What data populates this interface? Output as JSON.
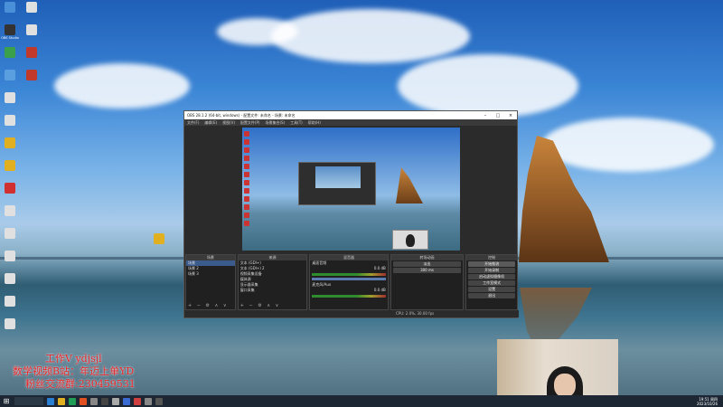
{
  "desktop": {
    "icons": [
      {
        "label": "",
        "color": "#4a90d9"
      },
      {
        "label": "",
        "color": "#e0e0e0"
      },
      {
        "label": "OBS Studio",
        "color": "#333333"
      },
      {
        "label": "",
        "color": "#e0e0e0"
      },
      {
        "label": "",
        "color": "#3aa04a"
      },
      {
        "label": "",
        "color": "#c0392b"
      },
      {
        "label": "",
        "color": "#5aa0e0"
      },
      {
        "label": "",
        "color": "#c0392b"
      },
      {
        "label": "",
        "color": "#e0e0e0"
      },
      {
        "label": "",
        "color": "#e0e0e0"
      },
      {
        "label": "",
        "color": "#e0b020"
      },
      {
        "label": "",
        "color": "#e0b020"
      },
      {
        "label": "",
        "color": "#d03030"
      },
      {
        "label": "",
        "color": "#e0e0e0"
      },
      {
        "label": "",
        "color": "#e0e0e0"
      },
      {
        "label": "",
        "color": "#e0e0e0"
      },
      {
        "label": "",
        "color": "#e0e0e0"
      },
      {
        "label": "",
        "color": "#e0e0e0"
      },
      {
        "label": "",
        "color": "#e0e0e0"
      }
    ]
  },
  "obs": {
    "title": "OBS 28.1.2 (64-bit, windows) - 配置文件: 未命名 - 场景: 未命名",
    "menu": [
      "文件(F)",
      "编辑(E)",
      "视图(V)",
      "配置文件(P)",
      "场景集合(S)",
      "工具(T)",
      "帮助(H)"
    ],
    "preview_note": "",
    "scenes_header": "场景",
    "scenes": [
      "场景",
      "场景 2",
      "场景 3"
    ],
    "sources_header": "来源",
    "sources": [
      "文本 (GDI+)",
      "文本 (GDI+) 2",
      "视频采集设备",
      "媒体源",
      "显示器采集",
      "窗口采集"
    ],
    "mixer_header": "混音器",
    "mixer": [
      {
        "name": "桌面音频",
        "db": "0.0 dB"
      },
      {
        "name": "麦克风/Aux",
        "db": "0.0 dB"
      }
    ],
    "transitions_header": "转场动画",
    "transition_type": "淡出",
    "transition_duration": "300 ms",
    "controls_header": "控制",
    "controls": [
      "开始推流",
      "开始录制",
      "启动虚拟摄像机",
      "工作室模式",
      "设置",
      "退出"
    ],
    "status": "CPU: 2.0%, 30.00 fps",
    "source_toolbar": "+ − ⚙ ∧ ∨"
  },
  "overlay": {
    "line1": "工作V ydjsjl",
    "line2": "数学视频B站：年迈上单YD",
    "line3": "粉丝交流群:230459531"
  },
  "taskbar": {
    "time": "19:51 周四",
    "date": "2023/10/26",
    "app_colors": [
      "#2a7fd4",
      "#e0b020",
      "#1f9d55",
      "#e05020",
      "#888888",
      "#444444",
      "#aaaaaa",
      "#3a6bd4",
      "#d04040",
      "#888888",
      "#555555"
    ]
  }
}
